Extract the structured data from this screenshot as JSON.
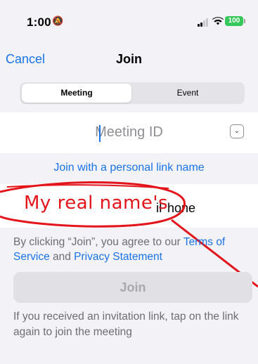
{
  "status_bar": {
    "time": "1:00",
    "battery": "100"
  },
  "nav": {
    "cancel_label": "Cancel",
    "title": "Join"
  },
  "segments": [
    "Meeting",
    "Event"
  ],
  "meeting_id_placeholder": "Meeting ID",
  "personal_link_label": "Join with a personal link name",
  "name_field_value": "iPhone",
  "annotation": "My real name's",
  "terms": {
    "prefix": "By clicking “Join”, you agree to our ",
    "terms_link": "Terms of Service",
    "middle": " and ",
    "privacy_link": "Privacy Statement"
  },
  "join_button_label": "Join",
  "help_text": "If you received an invitation link, tap on the link again to join the meeting",
  "colors": {
    "accent": "#1a73e8",
    "annotation": "#e3151b",
    "battery": "#34c759"
  }
}
